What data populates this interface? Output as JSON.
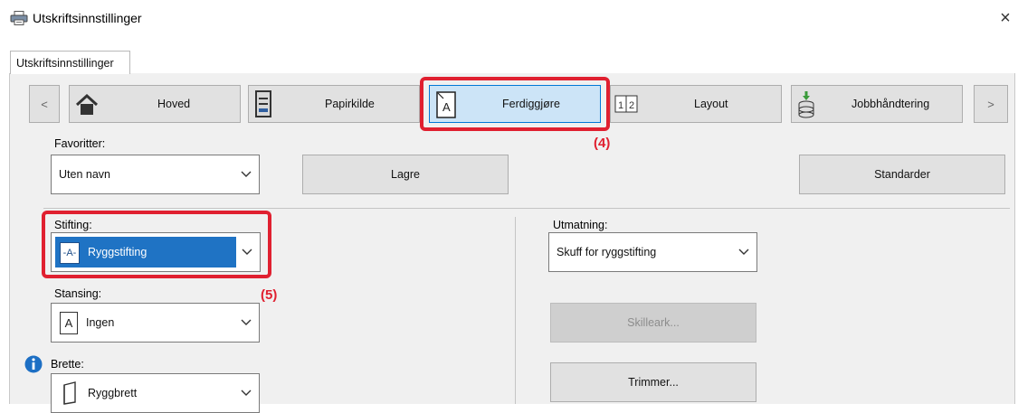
{
  "window": {
    "title": "Utskriftsinnstillinger",
    "close": "×",
    "icon": "printer-icon"
  },
  "tab": {
    "label": "Utskriftsinnstillinger"
  },
  "nav": {
    "prev": "<",
    "next": ">",
    "items": [
      {
        "label": "Hoved",
        "icon": "home-icon"
      },
      {
        "label": "Papirkilde",
        "icon": "paper-tray-icon"
      },
      {
        "label": "Ferdiggjøre",
        "icon": "finishing-page-icon",
        "selected": true
      },
      {
        "label": "Layout",
        "icon": "layout-1-2-icon"
      },
      {
        "label": "Jobbhåndtering",
        "icon": "job-stack-icon"
      }
    ],
    "layout_icon_text": "1|2",
    "ferdig_icon_letter": "A"
  },
  "favorites": {
    "label": "Favoritter:",
    "value": "Uten navn",
    "save": "Lagre",
    "defaults": "Standarder"
  },
  "stapling": {
    "label": "Stifting:",
    "value": "Ryggstifting",
    "icon_text": "-A-"
  },
  "punching": {
    "label": "Stansing:",
    "value": "Ingen",
    "icon_letter": "A"
  },
  "fold": {
    "label": "Brette:",
    "value": "Ryggbrett"
  },
  "output": {
    "label": "Utmatning:",
    "value": "Skuff for ryggstifting"
  },
  "buttons": {
    "separator": "Skilleark...",
    "trimmer": "Trimmer..."
  },
  "callouts": {
    "c4": "(4)",
    "c5": "(5)"
  },
  "colors": {
    "highlight": "#e02030",
    "selected": "#1f73c4",
    "info": "#1d6fc4"
  }
}
